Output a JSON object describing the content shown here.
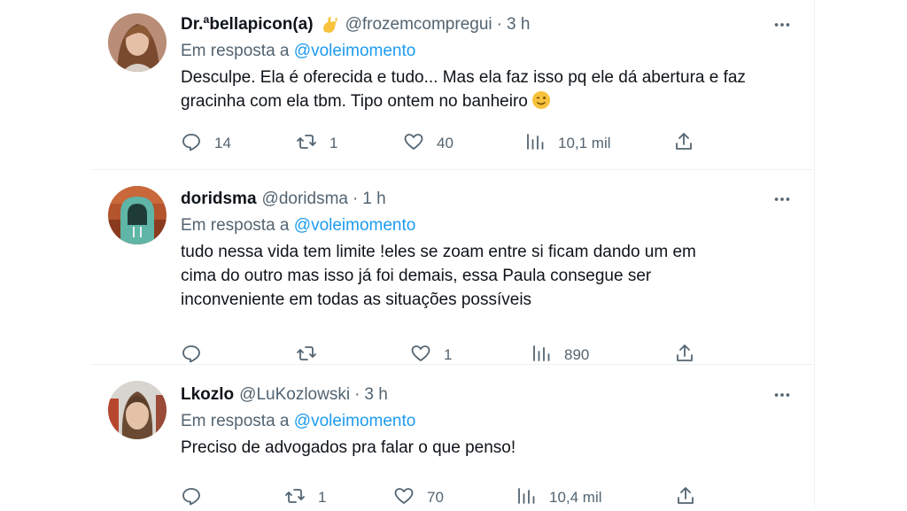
{
  "colors": {
    "accent": "#1d9bf0",
    "secondary_text": "#536471",
    "primary_text": "#0f1419",
    "divider": "#eff3f4"
  },
  "tweets": [
    {
      "name": "Dr.ªbellapicon(a)",
      "name_emoji": "call-me-hand-emoji",
      "handle": "@frozemcompregui",
      "dot": "·",
      "time": "3 h",
      "reply_prefix": "Em resposta a",
      "reply_mention": "@voleimomento",
      "text_lines": [
        "Desculpe. Ela é oferecida e tudo... Mas ela faz isso pq ele dá abertura e faz",
        "gracinha com ela tbm. Tipo ontem no banheiro"
      ],
      "text_emoji": "winking-face-emoji",
      "replies": "14",
      "retweets": "1",
      "likes": "40",
      "views": "10,1 mil"
    },
    {
      "name": "doridsma",
      "handle": "@doridsma",
      "dot": "·",
      "time": "1 h",
      "reply_prefix": "Em resposta a",
      "reply_mention": "@voleimomento",
      "text_lines": [
        "tudo nessa vida tem limite !eles se zoam entre si ficam dando um em",
        "cima do outro mas isso já foi demais, essa Paula consegue ser",
        "inconveniente em todas as situações possíveis"
      ],
      "replies": "",
      "retweets": "",
      "likes": "1",
      "views": "890"
    },
    {
      "name": "Lkozlo",
      "handle": "@LuKozlowski",
      "dot": "·",
      "time": "3 h",
      "reply_prefix": "Em resposta a",
      "reply_mention": "@voleimomento",
      "text_lines": [
        "Preciso de advogados pra falar o que penso!"
      ],
      "replies": "",
      "retweets": "1",
      "likes": "70",
      "views": "10,4 mil"
    }
  ],
  "icons": {
    "more": "more-horizontal-icon",
    "reply": "reply-icon",
    "retweet": "retweet-icon",
    "like": "heart-icon",
    "views": "views-chart-icon",
    "share": "share-icon"
  }
}
